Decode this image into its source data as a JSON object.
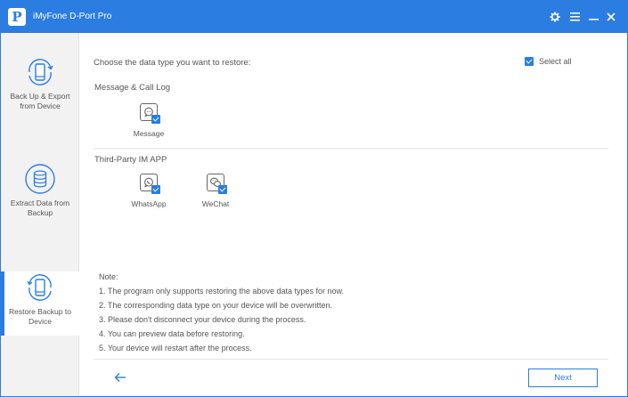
{
  "app": {
    "logo_letter": "P",
    "title": "iMyFone D-Port Pro"
  },
  "titlebar_icons": [
    "gear-icon",
    "menu-icon",
    "minimize-icon",
    "close-icon"
  ],
  "sidebar": {
    "items": [
      {
        "label_line1": "Back Up & Export",
        "label_line2": "from Device",
        "icon": "phone-backup-icon",
        "active": false
      },
      {
        "label_line1": "Extract Data from",
        "label_line2": "Backup",
        "icon": "database-icon",
        "active": false
      },
      {
        "label_line1": "Restore Backup to",
        "label_line2": "Device",
        "icon": "phone-restore-icon",
        "active": true
      }
    ]
  },
  "main": {
    "prompt": "Choose the data type you want to restore:",
    "select_all_label": "Select all",
    "select_all_checked": true,
    "sections": [
      {
        "title": "Message & Call Log",
        "items": [
          {
            "label": "Message",
            "icon": "message-icon",
            "checked": true
          }
        ]
      },
      {
        "title": "Third-Party IM APP",
        "items": [
          {
            "label": "WhatsApp",
            "icon": "whatsapp-icon",
            "checked": true
          },
          {
            "label": "WeChat",
            "icon": "wechat-icon",
            "checked": true
          }
        ]
      }
    ],
    "note": {
      "title": "Note:",
      "items": [
        "1. The program only supports restoring the above data types for now.",
        "2. The corresponding data type on your device will be overwritten.",
        "3. Please don't disconnect your device during the process.",
        "4. You can preview data before restoring.",
        "5. Your device will restart after the process."
      ]
    },
    "next_label": "Next",
    "back_icon": "arrow-left-icon"
  },
  "colors": {
    "accent": "#2b7de1",
    "sidebar_bg": "#f2f2f2",
    "text": "#555555"
  }
}
